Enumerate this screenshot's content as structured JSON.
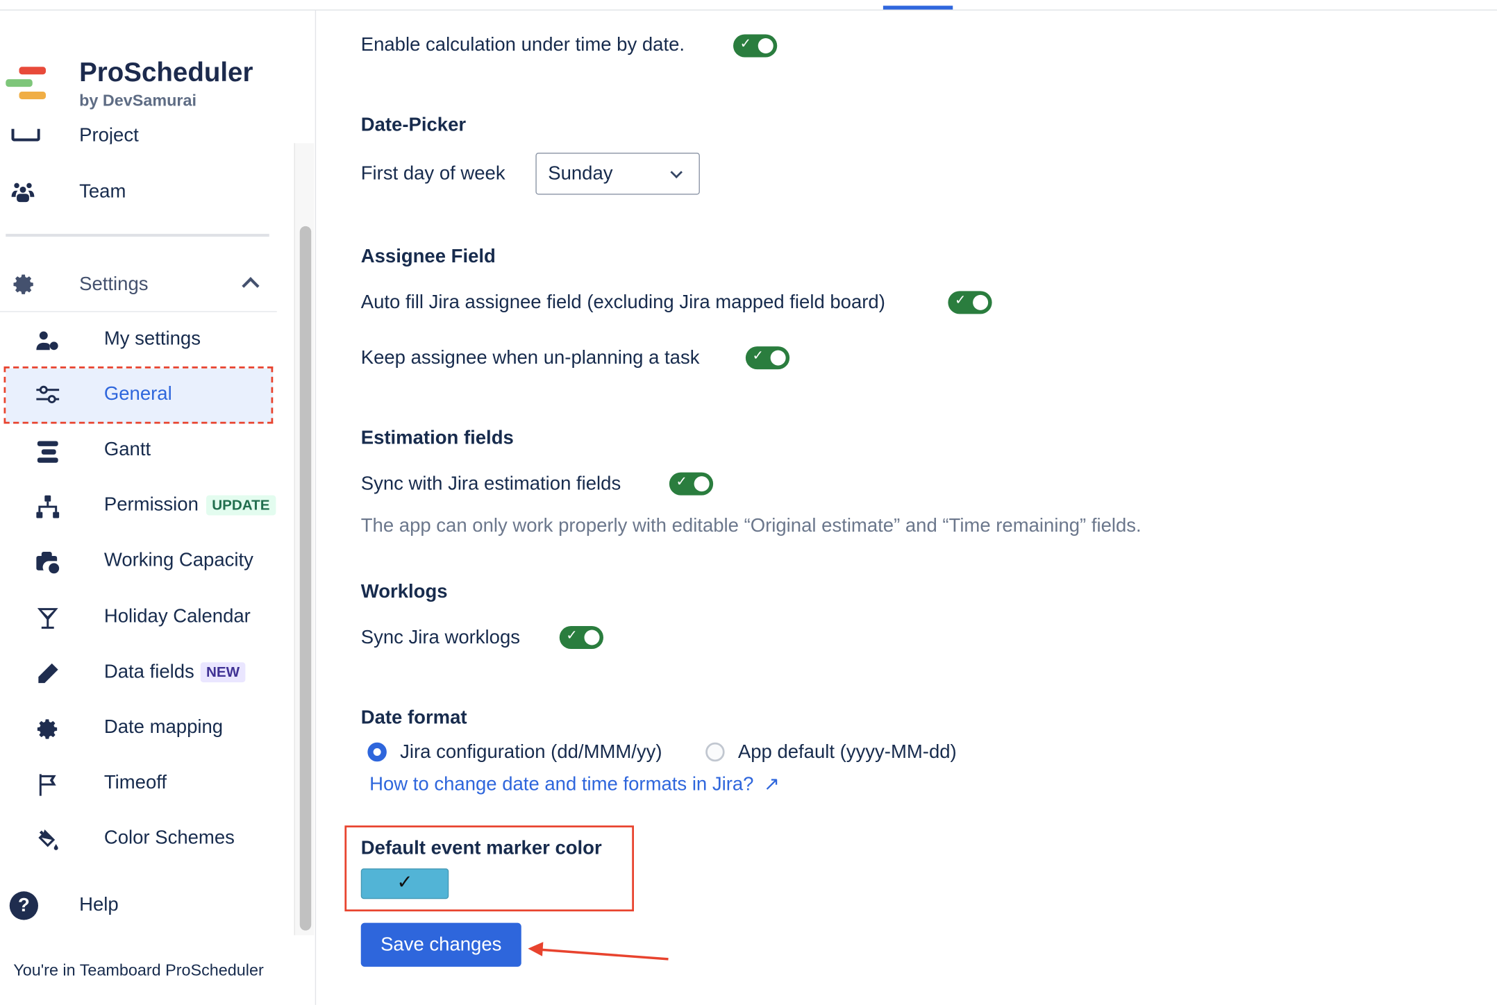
{
  "app": {
    "title": "ProScheduler",
    "subtitle": "by DevSamurai"
  },
  "sidebar": {
    "top_items": [
      {
        "label": "Project",
        "icon": "folder-icon"
      },
      {
        "label": "Team",
        "icon": "team-icon"
      }
    ],
    "settings": {
      "label": "Settings",
      "icon": "gear-icon",
      "expanded": true
    },
    "items": [
      {
        "label": "My settings",
        "icon": "user-gear-icon"
      },
      {
        "label": "General",
        "icon": "sliders-icon",
        "selected": true
      },
      {
        "label": "Gantt",
        "icon": "gantt-icon"
      },
      {
        "label": "Permission",
        "icon": "hierarchy-icon",
        "badge": "UPDATE"
      },
      {
        "label": "Working Capacity",
        "icon": "briefcase-clock-icon"
      },
      {
        "label": "Holiday Calendar",
        "icon": "cocktail-icon"
      },
      {
        "label": "Data fields",
        "icon": "pencil-icon",
        "badge": "NEW"
      },
      {
        "label": "Date mapping",
        "icon": "gear-icon"
      },
      {
        "label": "Timeoff",
        "icon": "flag-icon"
      },
      {
        "label": "Color Schemes",
        "icon": "paint-bucket-icon"
      }
    ],
    "help": "Help",
    "footer": "You're in Teamboard ProScheduler"
  },
  "main": {
    "calc_label": "Enable calculation under time by date.",
    "calc_on": true,
    "datepicker": {
      "heading": "Date-Picker",
      "label": "First day of week",
      "value": "Sunday"
    },
    "assignee": {
      "heading": "Assignee Field",
      "autofill_label": "Auto fill Jira assignee field (excluding Jira mapped field board)",
      "autofill_on": true,
      "keep_label": "Keep assignee when un-planning a task",
      "keep_on": true
    },
    "estimation": {
      "heading": "Estimation fields",
      "sync_label": "Sync with Jira estimation fields",
      "sync_on": true,
      "note": "The app can only work properly with editable “Original estimate” and “Time remaining” fields."
    },
    "worklogs": {
      "heading": "Worklogs",
      "sync_label": "Sync Jira worklogs",
      "sync_on": true
    },
    "date_format": {
      "heading": "Date format",
      "options": [
        "Jira configuration (dd/MMM/yy)",
        "App default (yyyy-MM-dd)"
      ],
      "selected": 0,
      "link": "How to change date and time formats in Jira?"
    },
    "marker": {
      "heading": "Default event marker color",
      "color": "#52b4d6"
    },
    "save_label": "Save changes"
  },
  "colors": {
    "accent": "#2e66dc",
    "toggle": "#2a7d3e",
    "annotation": "#e8432e"
  }
}
